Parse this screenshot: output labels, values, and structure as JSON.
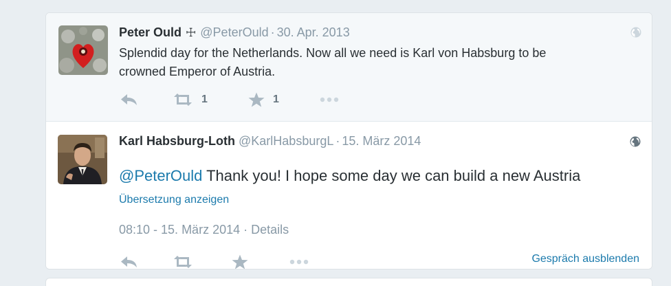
{
  "prev_tweet": {
    "fullname": "Peter Ould",
    "badge": "☩",
    "username": "@PeterOuld",
    "separator": "·",
    "timestamp": "30. Apr. 2013",
    "text_line1": "Splendid day for the Netherlands. Now all we need is Karl von Habsburg to be",
    "text_line2": "crowned Emperor of Austria.",
    "retweet_count": "1",
    "favorite_count": "1"
  },
  "main_tweet": {
    "fullname": "Karl Habsburg-Loth",
    "username": "@KarlHabsburgL",
    "separator": "·",
    "timestamp": "15. März 2014",
    "mention": "@PeterOuld",
    "text": " Thank you! I hope some day we can build a new Austria",
    "translate_label": "Übersetzung anzeigen",
    "full_time": "08:10 - 15. März 2014",
    "meta_separator": "·",
    "details_label": "Details",
    "hide_conversation_label": "Gespräch ausblenden"
  },
  "icons": {
    "reply": "reply-icon",
    "retweet": "retweet-icon",
    "favorite": "star-icon",
    "more": "more-icon",
    "globe": "globe-icon"
  },
  "colors": {
    "link": "#1b7aac",
    "muted": "#8899a6",
    "action_icon": "#aab8c2",
    "text": "#292f33"
  }
}
